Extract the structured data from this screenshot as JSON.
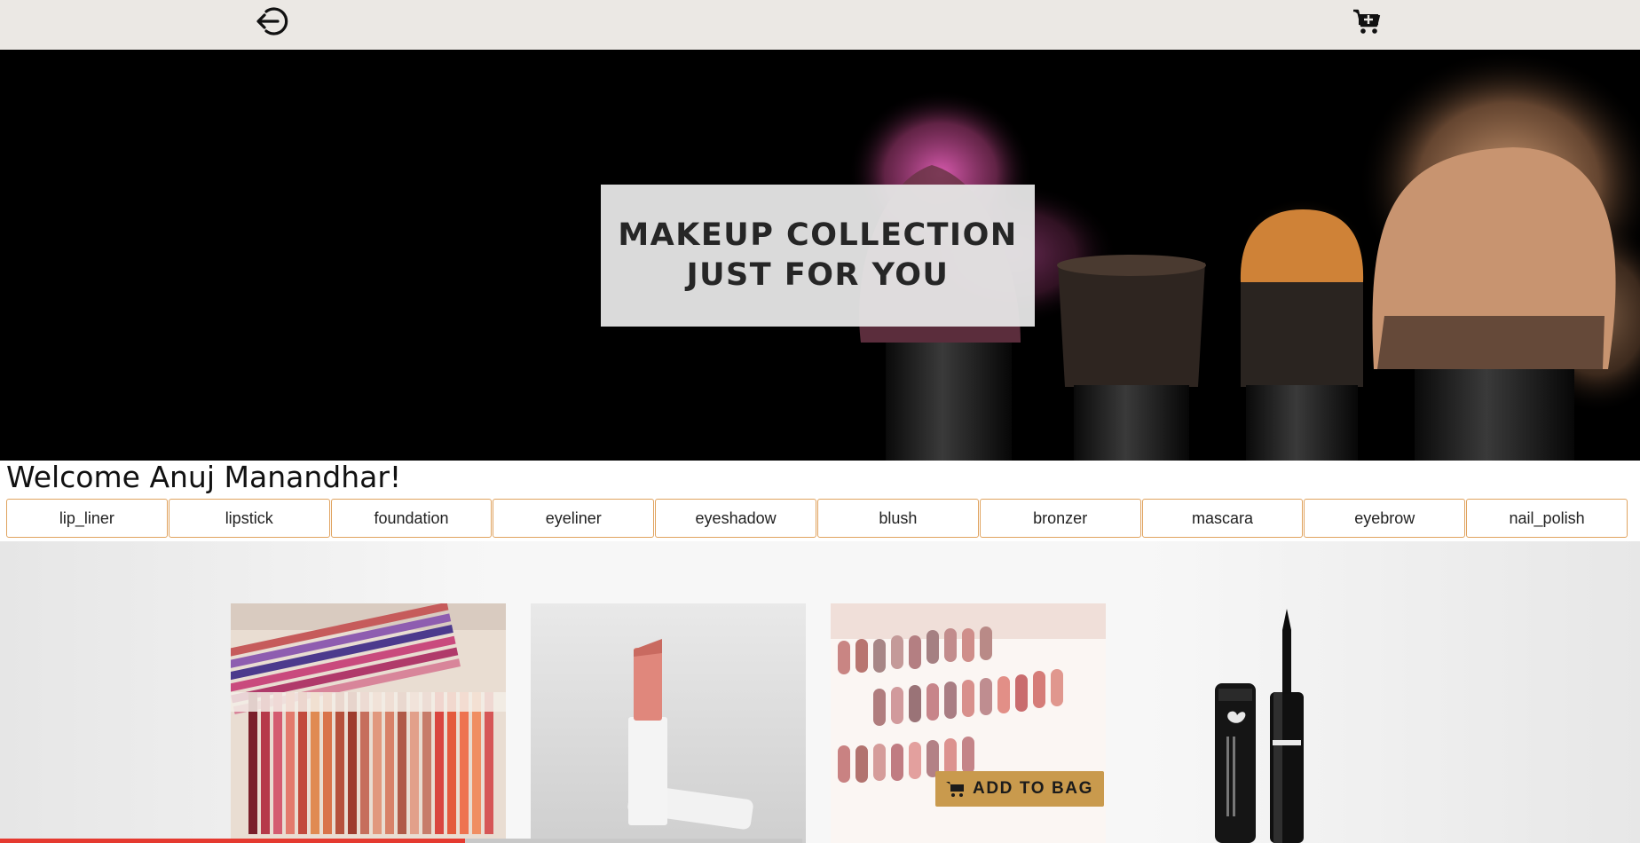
{
  "nav": {
    "logout_icon": "logout-icon",
    "cart_icon": "cart-add-icon"
  },
  "hero": {
    "line1": "MAKEUP COLLECTION",
    "line2": "JUST FOR YOU"
  },
  "welcome": "Welcome Anuj Manandhar!",
  "categories": [
    "lip_liner",
    "lipstick",
    "foundation",
    "eyeliner",
    "eyeshadow",
    "blush",
    "bronzer",
    "mascara",
    "eyebrow",
    "nail_polish"
  ],
  "products": [
    {
      "image": "lip-liner-pencils"
    },
    {
      "image": "lipstick"
    },
    {
      "image": "lipstick-swatches"
    },
    {
      "image": "eyeliner"
    }
  ],
  "add_to_bag": "ADD TO BAG",
  "colors": {
    "accent": "#c99a4d",
    "category_border": "#e0a35f",
    "progress": "#e53a30"
  },
  "video_progress": 0.28
}
